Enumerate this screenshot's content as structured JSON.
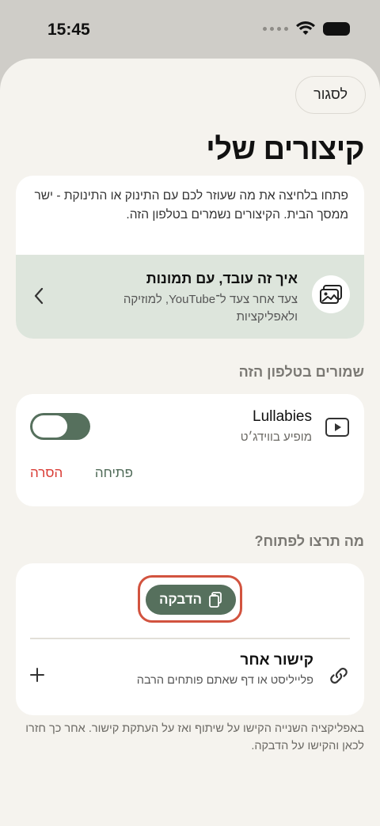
{
  "status_bar": {
    "time": "15:45"
  },
  "sheet": {
    "close_label": "לסגור",
    "title": "קיצורים שלי",
    "intro": "פתחו בלחיצה את מה שעוזר לכם עם התינוק או התינוקת - ישר ממסך הבית. הקיצורים נשמרים בטלפון הזה.",
    "howto": {
      "title": "איך זה עובד, עם תמונות",
      "subtitle": "צעד אחר צעד ל־YouTube, למוזיקה ולאפליקציות",
      "icon": "images-icon"
    },
    "saved_section": {
      "heading": "שמורים בטלפון הזה",
      "items": [
        {
          "name": "Lullabies",
          "subtitle": "מופיע בווידג׳ט",
          "enabled": true,
          "open_label": "פתיחה",
          "remove_label": "הסרה",
          "icon": "play-icon"
        }
      ]
    },
    "open_section": {
      "heading": "מה תרצו לפתוח?",
      "paste_label": "הדבקה",
      "other_link_title": "קישור אחר",
      "other_link_subtitle": "פלייליסט או דף שאתם פותחים הרבה"
    },
    "footnote": "באפליקציה השנייה הקישו על שיתוף ואז על העתקת קישור. אחר כך חזרו לכאן והקישו על הדבקה."
  },
  "colors": {
    "accent": "#56705d",
    "danger": "#d93a33",
    "highlight": "#d2533f"
  }
}
